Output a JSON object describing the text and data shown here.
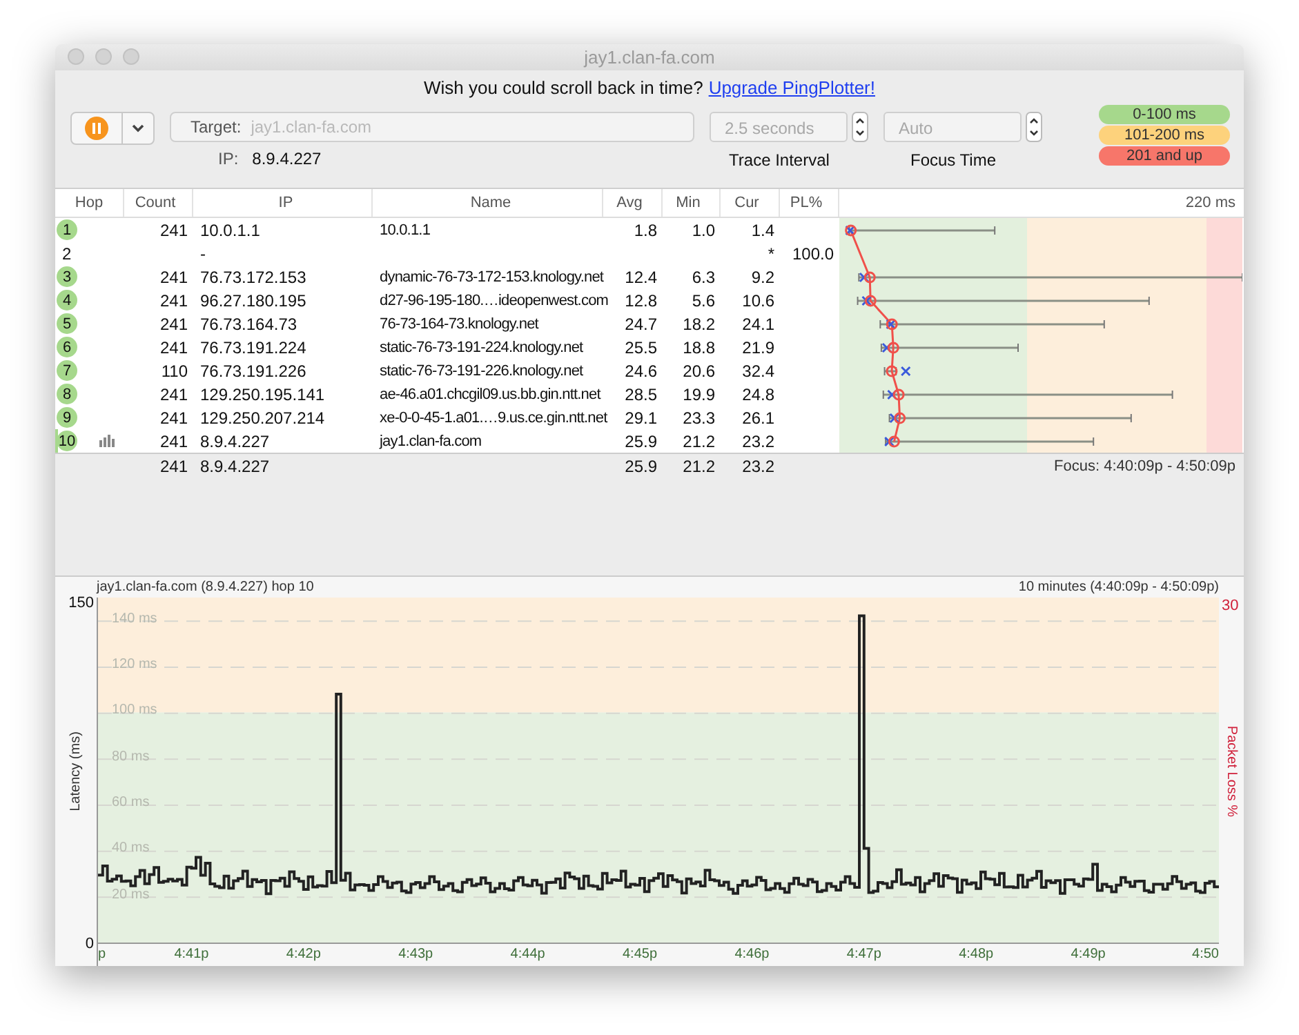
{
  "window": {
    "title": "jay1.clan-fa.com"
  },
  "banner": {
    "text": "Wish you could scroll back in time?",
    "link": "Upgrade PingPlotter!"
  },
  "toolbar": {
    "target_label": "Target:",
    "target_value": "jay1.clan-fa.com",
    "ip_label": "IP:",
    "ip_value": "8.9.4.227",
    "interval": {
      "value": "2.5 seconds",
      "label": "Trace Interval"
    },
    "focus": {
      "value": "Auto",
      "label": "Focus Time"
    }
  },
  "legend": [
    {
      "label": "0-100 ms",
      "color": "#a6d88c"
    },
    {
      "label": "101-200 ms",
      "color": "#fdd27c"
    },
    {
      "label": "201 and up",
      "color": "#f7766a"
    }
  ],
  "table": {
    "columns": [
      "Hop",
      "Count",
      "IP",
      "Name",
      "Avg",
      "Min",
      "Cur",
      "PL%"
    ],
    "graph_scale": "220 ms",
    "rows": [
      {
        "hop": "1",
        "count": "241",
        "ip": "10.0.1.1",
        "name": "10.0.1.1",
        "avg": "1.8",
        "min": "1.0",
        "cur": "1.4",
        "responded": true,
        "graphed": false
      },
      {
        "hop": "2",
        "ip": "-",
        "cur": "*",
        "pl": "100.0",
        "responded": false,
        "graphed": false
      },
      {
        "hop": "3",
        "count": "241",
        "ip": "76.73.172.153",
        "name": "dynamic-76-73-172-153.knology.net",
        "avg": "12.4",
        "min": "6.3",
        "cur": "9.2",
        "responded": true,
        "graphed": false
      },
      {
        "hop": "4",
        "count": "241",
        "ip": "96.27.180.195",
        "name": "d27-96-195-180.…ideopenwest.com",
        "avg": "12.8",
        "min": "5.6",
        "cur": "10.6",
        "responded": true,
        "graphed": false
      },
      {
        "hop": "5",
        "count": "241",
        "ip": "76.73.164.73",
        "name": "76-73-164-73.knology.net",
        "avg": "24.7",
        "min": "18.2",
        "cur": "24.1",
        "responded": true,
        "graphed": false
      },
      {
        "hop": "6",
        "count": "241",
        "ip": "76.73.191.224",
        "name": "static-76-73-191-224.knology.net",
        "avg": "25.5",
        "min": "18.8",
        "cur": "21.9",
        "responded": true,
        "graphed": false
      },
      {
        "hop": "7",
        "count": "110",
        "ip": "76.73.191.226",
        "name": "static-76-73-191-226.knology.net",
        "avg": "24.6",
        "min": "20.6",
        "cur": "32.4",
        "responded": true,
        "graphed": false
      },
      {
        "hop": "8",
        "count": "241",
        "ip": "129.250.195.141",
        "name": "ae-46.a01.chcgil09.us.bb.gin.ntt.net",
        "avg": "28.5",
        "min": "19.9",
        "cur": "24.8",
        "responded": true,
        "graphed": false
      },
      {
        "hop": "9",
        "count": "241",
        "ip": "129.250.207.214",
        "name": "xe-0-0-45-1.a01.…9.us.ce.gin.ntt.net",
        "avg": "29.1",
        "min": "23.3",
        "cur": "26.1",
        "responded": true,
        "graphed": false
      },
      {
        "hop": "10",
        "count": "241",
        "ip": "8.9.4.227",
        "name": "jay1.clan-fa.com",
        "avg": "25.9",
        "min": "21.2",
        "cur": "23.2",
        "responded": true,
        "graphed": true
      }
    ],
    "summary": {
      "count": "241",
      "ip": "8.9.4.227",
      "avg": "25.9",
      "min": "21.2",
      "cur": "23.2"
    },
    "focus": "Focus: 4:40:09p - 4:50:09p"
  },
  "chart": {
    "title": "jay1.clan-fa.com (8.9.4.227) hop 10",
    "range": "10 minutes (4:40:09p - 4:50:09p)",
    "y_max": "150",
    "y_min": "0",
    "loss_max": "30",
    "ylabel": "Latency (ms)",
    "loss_label": "Packet Loss %",
    "gridlines": [
      "140 ms",
      "120 ms",
      "100 ms",
      "80 ms",
      "60 ms",
      "40 ms",
      "20 ms"
    ],
    "xticks": [
      "p",
      "4:41p",
      "4:42p",
      "4:43p",
      "4:44p",
      "4:45p",
      "4:46p",
      "4:47p",
      "4:48p",
      "4:49p",
      "4:50"
    ]
  }
}
